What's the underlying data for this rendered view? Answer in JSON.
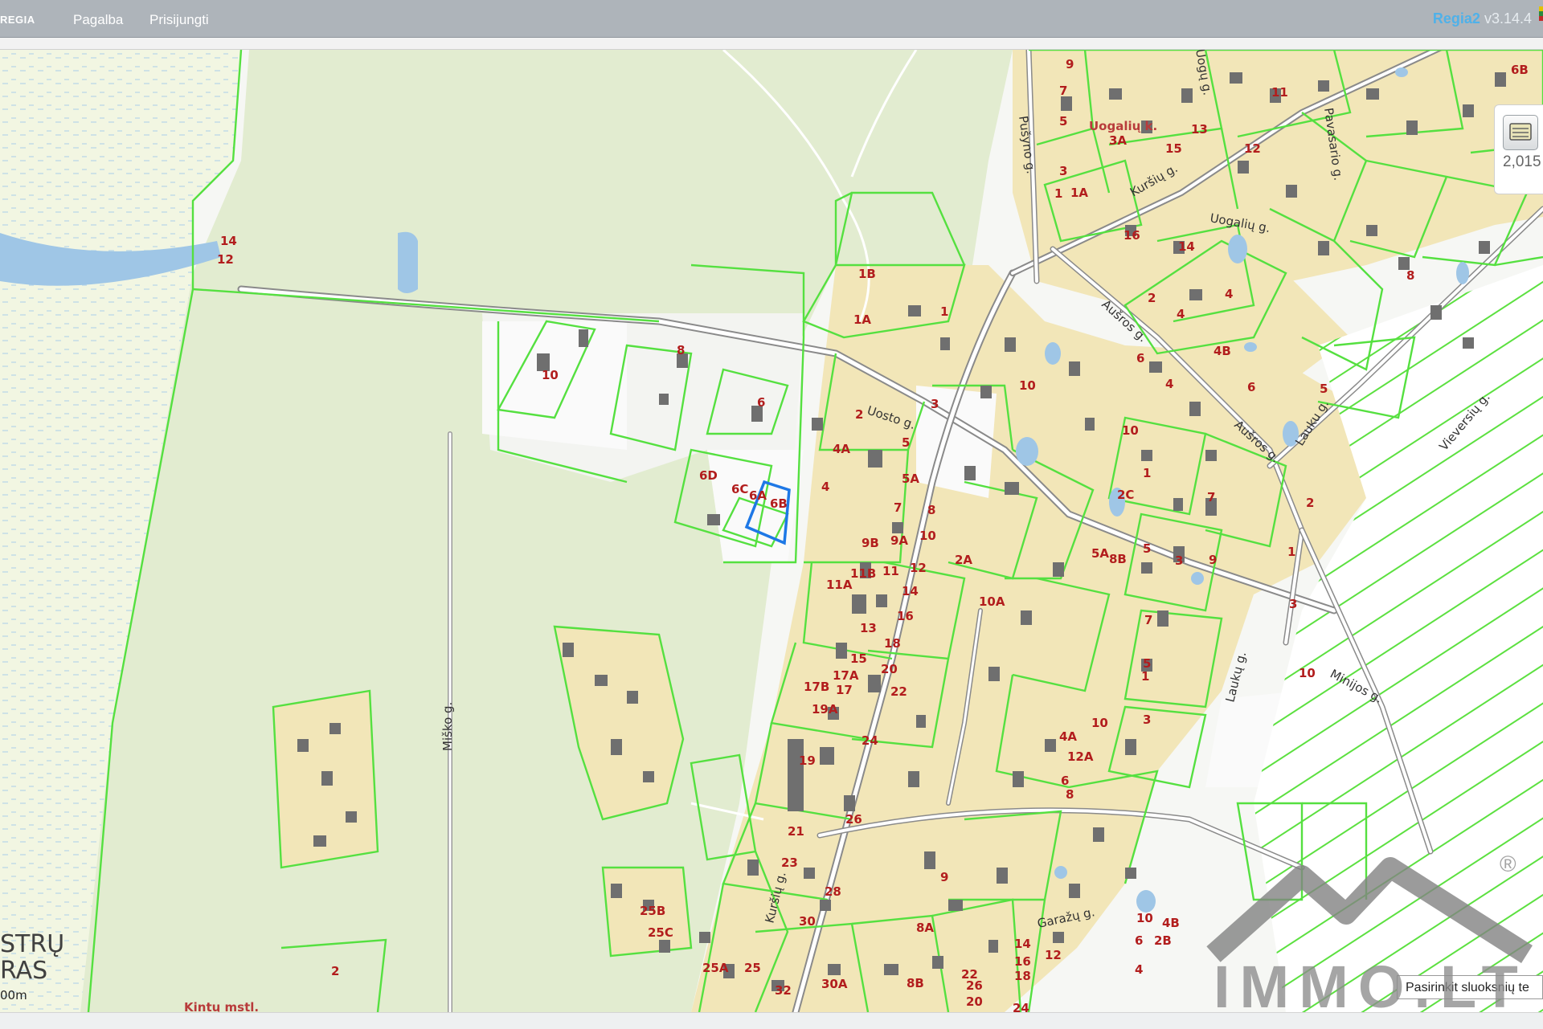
{
  "header": {
    "logo": "REGIA",
    "menu": [
      {
        "label": "Pagalba"
      },
      {
        "label": "Prisijungti"
      }
    ],
    "version_brand": "Regia2",
    "version_num": "v3.14.4"
  },
  "scale_panel": {
    "value": "2,015",
    "icon": "map-layers-icon"
  },
  "layer_hint": "Pasirinkit sluoksnių te",
  "watermark": {
    "text": "IMMO.LT",
    "reg": "®"
  },
  "map": {
    "streets": [
      "Uosto g.",
      "Kuršių g.",
      "Aušros g.",
      "Uogalių g.",
      "Pušyno g.",
      "Pavasario g.",
      "Lauku g.",
      "Vieversių g.",
      "Minijos g.",
      "Miško g.",
      "Garažų g.",
      "Laukų g.",
      "Uogų g."
    ],
    "places": [
      "Uogalių k.",
      "Kintų mstl."
    ],
    "water_label": [
      "STRŲ",
      "RAS"
    ],
    "scale_text": "00m",
    "parcel_labels": [
      "10",
      "14",
      "12",
      "6D",
      "6C",
      "6A",
      "6B",
      "4",
      "8",
      "6",
      "1A",
      "1B",
      "1",
      "3",
      "2",
      "5",
      "4A",
      "5A",
      "7",
      "8",
      "9A",
      "9B",
      "10",
      "11B",
      "11",
      "11A",
      "12",
      "14",
      "16",
      "13",
      "15",
      "18",
      "17A",
      "17B",
      "17",
      "19A",
      "20",
      "22",
      "24",
      "19",
      "21",
      "23",
      "26",
      "28",
      "30",
      "32",
      "30A",
      "25",
      "25A",
      "25B",
      "25C",
      "2",
      "9",
      "7",
      "5",
      "3",
      "1A",
      "1",
      "6B",
      "11",
      "12",
      "13",
      "15",
      "3A",
      "16",
      "14",
      "2",
      "4",
      "4B",
      "6",
      "8",
      "10",
      "2A",
      "10A",
      "12A",
      "4A",
      "6",
      "9",
      "8A",
      "8B",
      "26",
      "20",
      "22",
      "24",
      "18",
      "16",
      "14",
      "12",
      "10",
      "4B",
      "2B",
      "2C",
      "5A",
      "5",
      "3",
      "7",
      "9",
      "1",
      "10",
      "6",
      "4",
      "8B",
      "4",
      "6",
      "8",
      "10",
      "3",
      "5",
      "1",
      "7",
      "1",
      "2",
      "3",
      "4",
      "5",
      "10"
    ]
  }
}
